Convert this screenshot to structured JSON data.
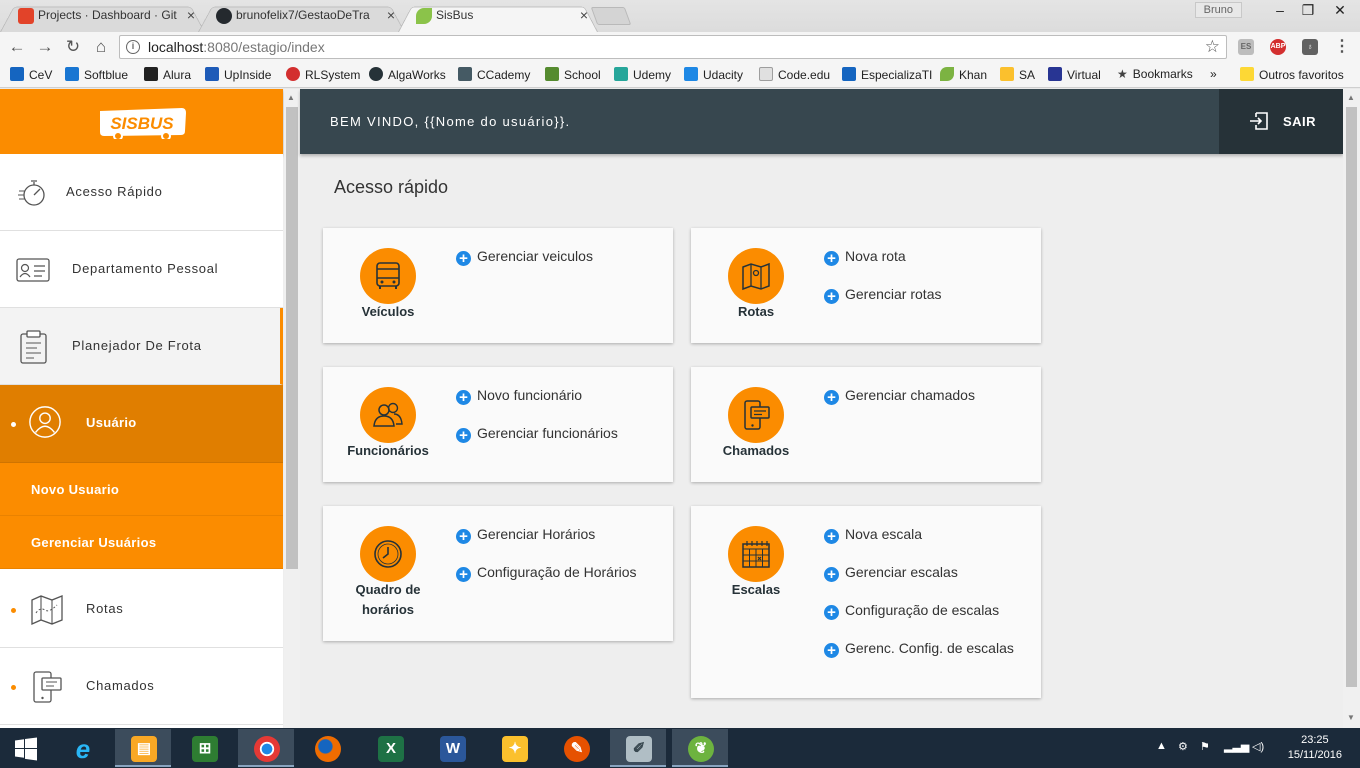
{
  "browser": {
    "tabs": [
      {
        "title": "Projects · Dashboard · Git",
        "favicon_color": "#e24329",
        "active": false
      },
      {
        "title": "brunofelix7/GestaoDeTra",
        "favicon_color": "#24292e",
        "active": false
      },
      {
        "title": "SisBus",
        "favicon_color": "#8bc34a",
        "active": true
      }
    ],
    "close_glyph": "×",
    "user_badge": "Bruno",
    "window_controls": {
      "minimize": "–",
      "maximize": "❐",
      "close": "✕"
    },
    "nav": {
      "back": "←",
      "forward": "→",
      "reload": "↻",
      "home": "⌂"
    },
    "url_host": "localhost",
    "url_path": ":8080/estagio/index",
    "extensions": [
      {
        "label": "ES",
        "color": "#9e9e9e"
      },
      {
        "label": "ABP",
        "color": "#d32f2f"
      },
      {
        "label": "♁",
        "color": "#616161"
      },
      {
        "label": "⋮",
        "color": "#f5f5f5"
      }
    ],
    "bookmarks": [
      {
        "label": "CeV",
        "color": "#1565c0"
      },
      {
        "label": "Softblue",
        "color": "#1976d2"
      },
      {
        "label": "Alura",
        "color": "#212121"
      },
      {
        "label": "UpInside",
        "color": "#1e5bb8"
      },
      {
        "label": "RLSystem",
        "color": "#d32f2f"
      },
      {
        "label": "AlgaWorks",
        "color": "#263238"
      },
      {
        "label": "CCademy",
        "color": "#455a64"
      },
      {
        "label": "School",
        "color": "#558b2f"
      },
      {
        "label": "Udemy",
        "color": "#26a69a"
      },
      {
        "label": "Udacity",
        "color": "#1e88e5"
      },
      {
        "label": "Code.edu",
        "color": "#9e9e9e"
      },
      {
        "label": "EspecializaTI",
        "color": "#1565c0"
      },
      {
        "label": "Khan",
        "color": "#7cb342"
      },
      {
        "label": "SA",
        "color": "#fbc02d"
      },
      {
        "label": "Virtual",
        "color": "#283593"
      },
      {
        "label": "Bookmarks",
        "color": "#424242"
      }
    ],
    "bookmarks_more": "»",
    "other_favorites": "Outros favoritos"
  },
  "app": {
    "logo_text": "SISBUS",
    "welcome": "BEM VINDO, {{Nome do usuário}}.",
    "logout_label": "SAIR",
    "accent": "#fb8c00",
    "sidebar": {
      "items": [
        {
          "label": "Acesso Rápido",
          "icon": "stopwatch-icon"
        },
        {
          "label": "Departamento Pessoal",
          "icon": "id-card-icon"
        },
        {
          "label": "Planejador De Frota",
          "icon": "clipboard-icon"
        },
        {
          "label": "Usuário",
          "icon": "user-icon"
        },
        {
          "label": "Rotas",
          "icon": "map-icon"
        },
        {
          "label": "Chamados",
          "icon": "phone-chat-icon"
        }
      ],
      "submenu": [
        {
          "label": "Novo Usuario"
        },
        {
          "label": "Gerenciar Usuários"
        }
      ]
    },
    "section_title": "Acesso rápido",
    "cards": [
      {
        "name": "Veículos",
        "icon": "bus-icon",
        "actions": [
          "Gerenciar veiculos"
        ]
      },
      {
        "name": "Rotas",
        "icon": "map-icon",
        "actions": [
          "Nova rota",
          "Gerenciar rotas"
        ]
      },
      {
        "name": "Funcionários",
        "icon": "people-icon",
        "actions": [
          "Novo funcionário",
          "Gerenciar funcionários"
        ]
      },
      {
        "name": "Chamados",
        "icon": "phone-chat-icon",
        "actions": [
          "Gerenciar chamados"
        ]
      },
      {
        "name_line1": "Quadro de",
        "name_line2": "horários",
        "icon": "clock-icon",
        "actions": [
          "Gerenciar Horários",
          "Configuração de Horários"
        ]
      },
      {
        "name": "Escalas",
        "icon": "calendar-icon",
        "actions": [
          "Nova escala",
          "Gerenciar escalas",
          "Configuração de escalas",
          "Gerenc. Config. de escalas"
        ]
      }
    ]
  },
  "taskbar": {
    "apps": [
      {
        "name": "windows-start-icon",
        "glyph": "⊞",
        "color": "#1b2a3a"
      },
      {
        "name": "internet-explorer-icon",
        "glyph": "e",
        "color": "#1e88e5"
      },
      {
        "name": "file-explorer-icon",
        "glyph": "▤",
        "color": "#f9a825"
      },
      {
        "name": "store-icon",
        "glyph": "⊞",
        "color": "#2e7d32"
      },
      {
        "name": "chrome-icon",
        "glyph": "◉",
        "color": "#e53935"
      },
      {
        "name": "firefox-icon",
        "glyph": "◕",
        "color": "#ef6c00"
      },
      {
        "name": "excel-icon",
        "glyph": "X",
        "color": "#1e7145"
      },
      {
        "name": "word-icon",
        "glyph": "W",
        "color": "#2b579a"
      },
      {
        "name": "bulb-icon",
        "glyph": "✦",
        "color": "#fbc02d"
      },
      {
        "name": "tools-icon",
        "glyph": "✎",
        "color": "#e65100"
      },
      {
        "name": "notepad-icon",
        "glyph": "✐",
        "color": "#78909c"
      },
      {
        "name": "spring-icon",
        "glyph": "❦",
        "color": "#6db33f"
      }
    ],
    "time": "23:25",
    "date": "15/11/2016"
  }
}
